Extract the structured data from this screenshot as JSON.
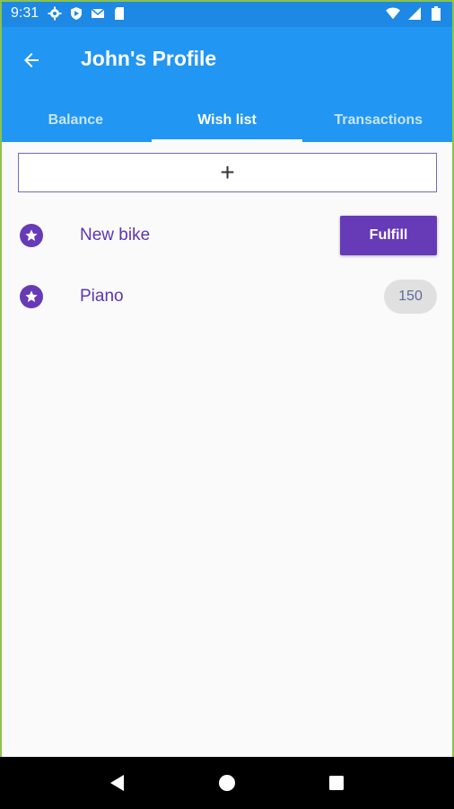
{
  "status_bar": {
    "time": "9:31",
    "left_icons": [
      "settings-icon",
      "shield-icon",
      "gmail-icon",
      "sd-card-icon"
    ],
    "right_icons": [
      "wifi-icon",
      "signal-icon",
      "battery-icon"
    ]
  },
  "app_bar": {
    "title": "John's Profile",
    "color": "#2196f3"
  },
  "tabs": [
    {
      "label": "Balance",
      "active": false
    },
    {
      "label": "Wish list",
      "active": true
    },
    {
      "label": "Transactions",
      "active": false
    }
  ],
  "add_button": {
    "label": "+"
  },
  "wish_list": [
    {
      "label": "New bike",
      "action": "Fulfill"
    },
    {
      "label": "Piano",
      "price": "150"
    }
  ],
  "accent_color": "#673ab7",
  "nav_bar": {
    "buttons": [
      "back-triangle-icon",
      "home-circle-icon",
      "recents-square-icon"
    ]
  }
}
